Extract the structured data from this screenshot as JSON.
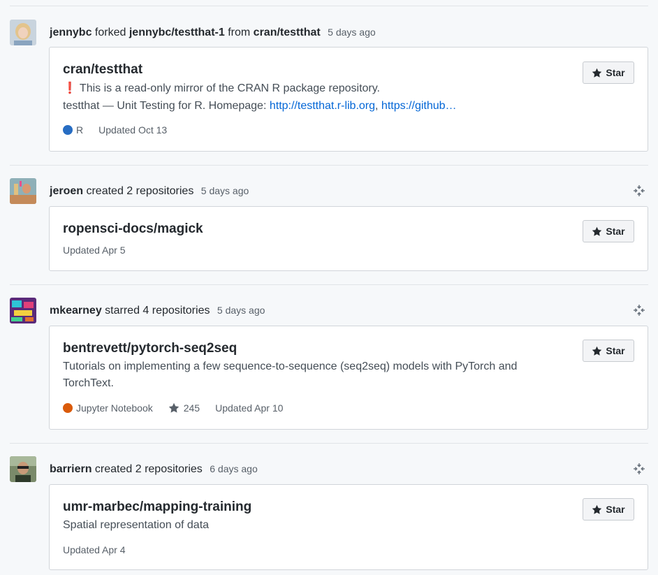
{
  "events": [
    {
      "actor": "jennybc",
      "verb": "forked",
      "target": "jennybc/testthat-1",
      "connector": "from",
      "source": "cran/testthat",
      "time": "5 days ago",
      "card": {
        "title": "cran/testthat",
        "warning_icon": "exclamation-icon",
        "desc_line1": "This is a read-only mirror of the CRAN R package repository.",
        "desc_line2_prefix": "testthat — Unit Testing for R. Homepage: ",
        "link1": "http://testthat.r-lib.org",
        "link_sep": ", ",
        "link2": "https://github…",
        "language": "R",
        "language_color": "#276dc3",
        "updated": "Updated Oct 13",
        "star_label": "Star"
      }
    },
    {
      "actor": "jeroen",
      "verb": "created 2 repositories",
      "time": "5 days ago",
      "card": {
        "title": "ropensci-docs/magick",
        "updated": "Updated Apr 5",
        "star_label": "Star"
      }
    },
    {
      "actor": "mkearney",
      "verb": "starred 4 repositories",
      "time": "5 days ago",
      "card": {
        "title": "bentrevett/pytorch-seq2seq",
        "desc": "Tutorials on implementing a few sequence-to-sequence (seq2seq) models with PyTorch and TorchText.",
        "language": "Jupyter Notebook",
        "language_color": "#da5b0b",
        "stars": "245",
        "updated": "Updated Apr 10",
        "star_label": "Star"
      }
    },
    {
      "actor": "barriern",
      "verb": "created 2 repositories",
      "time": "6 days ago",
      "card": {
        "title": "umr-marbec/mapping-training",
        "desc": "Spatial representation of data",
        "updated": "Updated Apr 4",
        "star_label": "Star"
      }
    }
  ]
}
